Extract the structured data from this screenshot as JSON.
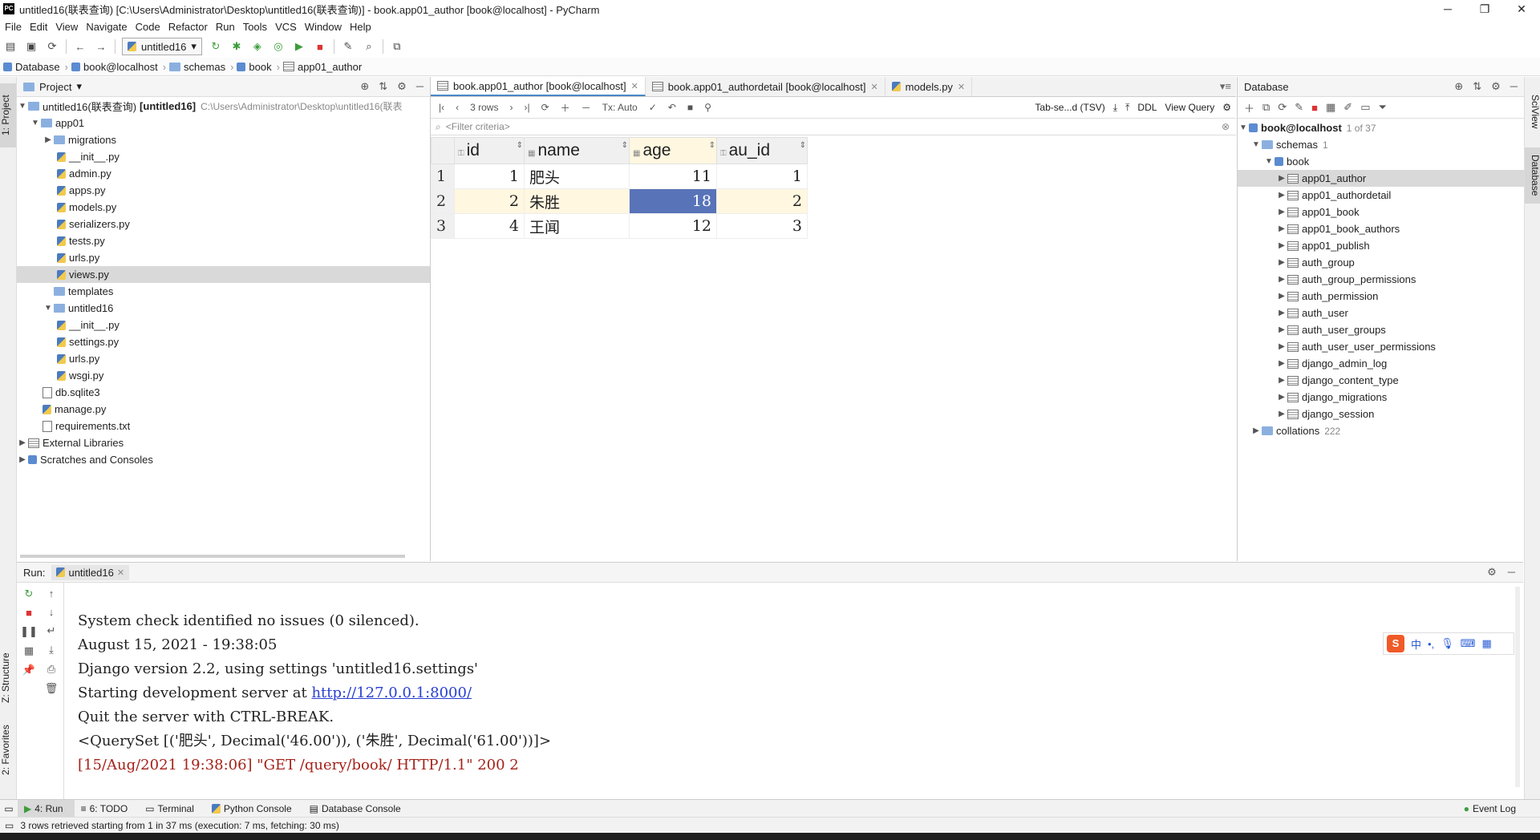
{
  "window": {
    "title": "untitled16(联表查询) [C:\\Users\\Administrator\\Desktop\\untitled16(联表查询)] - book.app01_author [book@localhost] - PyCharm",
    "logo": "PC",
    "controls": [
      "─",
      "❐",
      "✕"
    ]
  },
  "menu": [
    "File",
    "Edit",
    "View",
    "Navigate",
    "Code",
    "Refactor",
    "Run",
    "Tools",
    "VCS",
    "Window",
    "Help"
  ],
  "toolbar": {
    "run_config": "untitled16"
  },
  "breadcrumb": [
    "Database",
    "book@localhost",
    "schemas",
    "book",
    "app01_author"
  ],
  "left_strip": {
    "project": "1: Project",
    "structure": "Z: Structure",
    "favorites": "2: Favorites"
  },
  "right_strip": {
    "sciview": "SciView",
    "database": "Database"
  },
  "project": {
    "header": "Project",
    "rows": [
      {
        "label": "untitled16(联表查询)",
        "bold": "[untitled16]",
        "path": "C:\\Users\\Administrator\\Desktop\\untitled16(联表"
      },
      {
        "label": "app01"
      },
      {
        "label": "migrations"
      },
      {
        "label": "__init__.py"
      },
      {
        "label": "admin.py"
      },
      {
        "label": "apps.py"
      },
      {
        "label": "models.py"
      },
      {
        "label": "serializers.py"
      },
      {
        "label": "tests.py"
      },
      {
        "label": "urls.py"
      },
      {
        "label": "views.py"
      },
      {
        "label": "templates"
      },
      {
        "label": "untitled16"
      },
      {
        "label": "__init__.py"
      },
      {
        "label": "settings.py"
      },
      {
        "label": "urls.py"
      },
      {
        "label": "wsgi.py"
      },
      {
        "label": "db.sqlite3"
      },
      {
        "label": "manage.py"
      },
      {
        "label": "requirements.txt"
      },
      {
        "label": "External Libraries"
      },
      {
        "label": "Scratches and Consoles"
      }
    ]
  },
  "editor": {
    "tabs": [
      {
        "label": "book.app01_author [book@localhost]"
      },
      {
        "label": "book.app01_authordetail [book@localhost]"
      },
      {
        "label": "models.py"
      }
    ],
    "grid_toolbar": {
      "rows": "3 rows",
      "tx": "Tx: Auto",
      "format": "Tab-se...d (TSV)",
      "ddl": "DDL",
      "view_query": "View Query"
    },
    "filter_placeholder": "<Filter criteria>",
    "columns": [
      "id",
      "name",
      "age",
      "au_id"
    ],
    "rows": [
      {
        "rn": "1",
        "id": "1",
        "name": "肥头",
        "age": "11",
        "au_id": "1"
      },
      {
        "rn": "2",
        "id": "2",
        "name": "朱胜",
        "age": "18",
        "au_id": "2"
      },
      {
        "rn": "3",
        "id": "4",
        "name": "王闻",
        "age": "12",
        "au_id": "3"
      }
    ]
  },
  "database": {
    "header": "Database",
    "root": "book@localhost",
    "root_count": "1 of 37",
    "schemas": "schemas",
    "schemas_count": "1",
    "schema": "book",
    "tables": [
      "app01_author",
      "app01_authordetail",
      "app01_book",
      "app01_book_authors",
      "app01_publish",
      "auth_group",
      "auth_group_permissions",
      "auth_permission",
      "auth_user",
      "auth_user_groups",
      "auth_user_user_permissions",
      "django_admin_log",
      "django_content_type",
      "django_migrations",
      "django_session"
    ],
    "collations": "collations",
    "collations_count": "222"
  },
  "run": {
    "label": "Run:",
    "tab": "untitled16",
    "lines": {
      "l1": "System check identified no issues (0 silenced).",
      "l2": "August 15, 2021 - 19:38:05",
      "l3": "Django version 2.2, using settings 'untitled16.settings'",
      "l4a": "Starting development server at ",
      "l4b": "http://127.0.0.1:8000/",
      "l5": "Quit the server with CTRL-BREAK.",
      "l6": "<QuerySet [('肥头', Decimal('46.00')), ('朱胜', Decimal('61.00'))]>",
      "l7": "[15/Aug/2021 19:38:06] \"GET /query/book/ HTTP/1.1\" 200 2"
    }
  },
  "ime": {
    "logo": "S",
    "mode": "中"
  },
  "bottom_tabs": [
    "4: Run",
    "6: TODO",
    "Terminal",
    "Python Console",
    "Database Console"
  ],
  "event_log": "Event Log",
  "status": "3 rows retrieved starting from 1 in 37 ms (execution: 7 ms, fetching: 30 ms)"
}
